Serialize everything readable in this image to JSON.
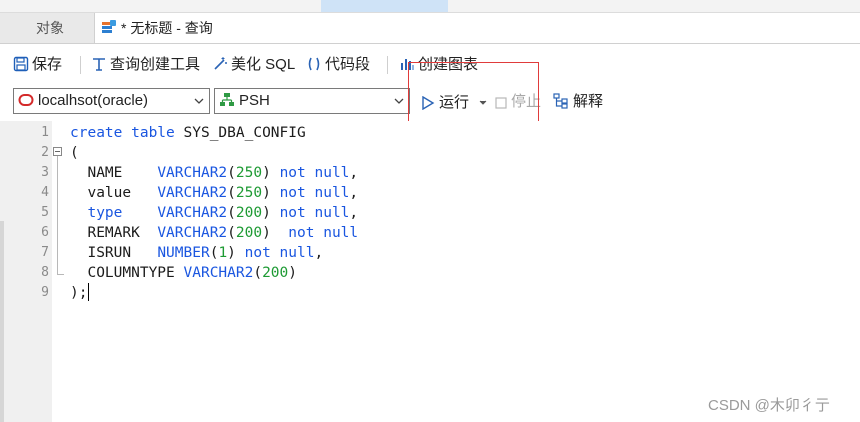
{
  "menubar": {
    "items": [
      "",
      "",
      "",
      "",
      "",
      "",
      "",
      "",
      ""
    ]
  },
  "tabs": {
    "objects": "对象",
    "query": "* 无标题 - 查询"
  },
  "toolbar": {
    "save": "保存",
    "query_builder": "查询创建工具",
    "beautify": "美化 SQL",
    "snippet": "代码段",
    "create_chart": "创建图表"
  },
  "toolbar2": {
    "connection": "localhsot(oracle)",
    "schema": "PSH",
    "run": "运行",
    "stop": "停止",
    "explain": "解释"
  },
  "editor": {
    "line_numbers": [
      "1",
      "2",
      "3",
      "4",
      "5",
      "6",
      "7",
      "8",
      "9"
    ],
    "lines": [
      [
        {
          "t": "create table ",
          "c": "kw"
        },
        {
          "t": "SYS_DBA_CONFIG",
          "c": ""
        }
      ],
      [
        {
          "t": "(",
          "c": ""
        }
      ],
      [
        {
          "t": "  NAME    ",
          "c": ""
        },
        {
          "t": "VARCHAR2",
          "c": "kw"
        },
        {
          "t": "(",
          "c": ""
        },
        {
          "t": "250",
          "c": "num"
        },
        {
          "t": ") ",
          "c": ""
        },
        {
          "t": "not null",
          "c": "kw"
        },
        {
          "t": ",",
          "c": ""
        }
      ],
      [
        {
          "t": "  value   ",
          "c": ""
        },
        {
          "t": "VARCHAR2",
          "c": "kw"
        },
        {
          "t": "(",
          "c": ""
        },
        {
          "t": "250",
          "c": "num"
        },
        {
          "t": ") ",
          "c": ""
        },
        {
          "t": "not null",
          "c": "kw"
        },
        {
          "t": ",",
          "c": ""
        }
      ],
      [
        {
          "t": "  ",
          "c": ""
        },
        {
          "t": "type",
          "c": "kw"
        },
        {
          "t": "    ",
          "c": ""
        },
        {
          "t": "VARCHAR2",
          "c": "kw"
        },
        {
          "t": "(",
          "c": ""
        },
        {
          "t": "200",
          "c": "num"
        },
        {
          "t": ") ",
          "c": ""
        },
        {
          "t": "not null",
          "c": "kw"
        },
        {
          "t": ",",
          "c": ""
        }
      ],
      [
        {
          "t": "  REMARK  ",
          "c": ""
        },
        {
          "t": "VARCHAR2",
          "c": "kw"
        },
        {
          "t": "(",
          "c": ""
        },
        {
          "t": "200",
          "c": "num"
        },
        {
          "t": ")  ",
          "c": ""
        },
        {
          "t": "not null",
          "c": "kw"
        }
      ],
      [
        {
          "t": "  ISRUN   ",
          "c": ""
        },
        {
          "t": "NUMBER",
          "c": "kw"
        },
        {
          "t": "(",
          "c": ""
        },
        {
          "t": "1",
          "c": "num"
        },
        {
          "t": ") ",
          "c": ""
        },
        {
          "t": "not null",
          "c": "kw"
        },
        {
          "t": ",",
          "c": ""
        }
      ],
      [
        {
          "t": "  COLUMNTYPE ",
          "c": ""
        },
        {
          "t": "VARCHAR2",
          "c": "kw"
        },
        {
          "t": "(",
          "c": ""
        },
        {
          "t": "200",
          "c": "num"
        },
        {
          "t": ")",
          "c": ""
        }
      ],
      [
        {
          "t": ");",
          "c": ""
        }
      ]
    ]
  },
  "watermark": "CSDN @木卯彳亍",
  "colors": {
    "keyword": "#1a56e0",
    "number": "#1d9a33",
    "highlight_box": "#e03b3b"
  }
}
